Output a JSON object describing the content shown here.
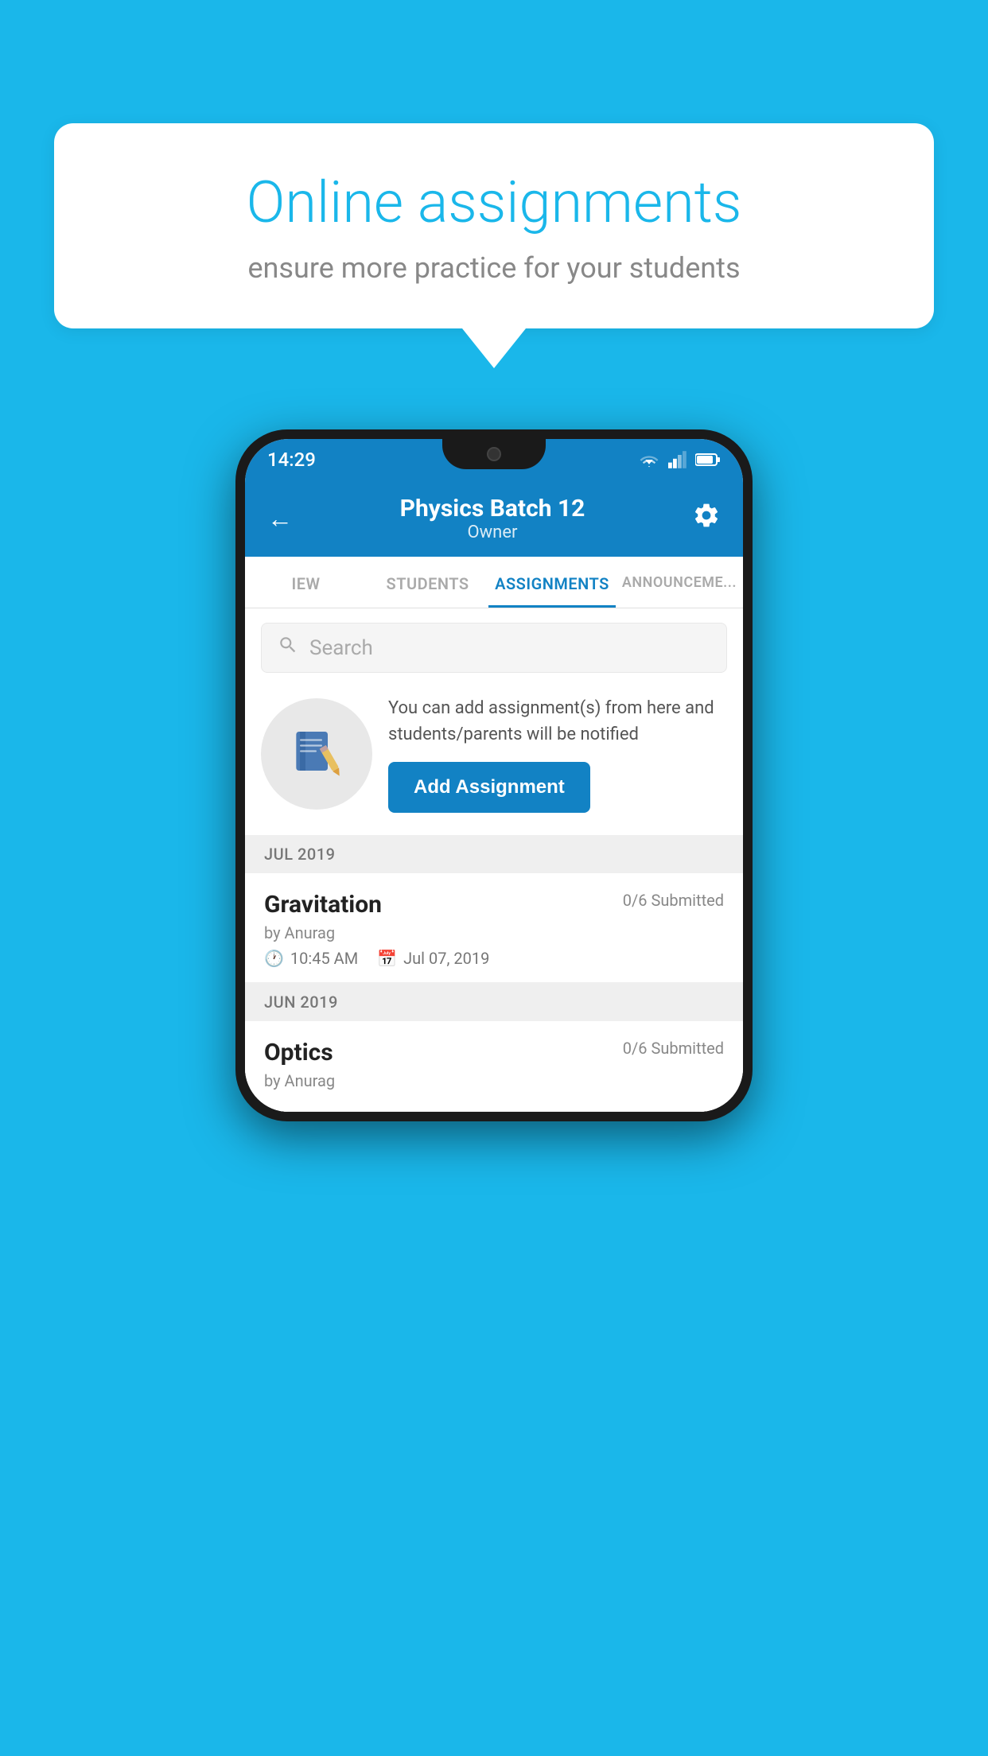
{
  "background": {
    "color": "#1ab7ea"
  },
  "speech_bubble": {
    "title": "Online assignments",
    "subtitle": "ensure more practice for your students"
  },
  "phone": {
    "status_bar": {
      "time": "14:29"
    },
    "header": {
      "title": "Physics Batch 12",
      "subtitle": "Owner"
    },
    "tabs": [
      {
        "label": "IEW",
        "active": false
      },
      {
        "label": "STUDENTS",
        "active": false
      },
      {
        "label": "ASSIGNMENTS",
        "active": true
      },
      {
        "label": "ANNOUNCEMENTS",
        "active": false
      }
    ],
    "search": {
      "placeholder": "Search"
    },
    "promo": {
      "description": "You can add assignment(s) from here and students/parents will be notified",
      "button_label": "Add Assignment"
    },
    "sections": [
      {
        "label": "JUL 2019",
        "assignments": [
          {
            "title": "Gravitation",
            "submitted": "0/6 Submitted",
            "by": "by Anurag",
            "time": "10:45 AM",
            "date": "Jul 07, 2019"
          }
        ]
      },
      {
        "label": "JUN 2019",
        "assignments": [
          {
            "title": "Optics",
            "submitted": "0/6 Submitted",
            "by": "by Anurag",
            "time": "",
            "date": ""
          }
        ]
      }
    ]
  }
}
